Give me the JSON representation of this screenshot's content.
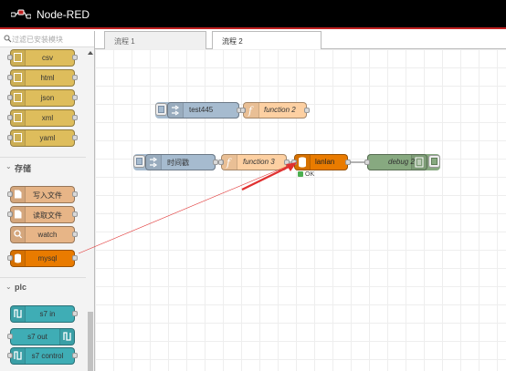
{
  "app": {
    "title": "Node-RED"
  },
  "palette": {
    "search_placeholder": "过滤已安装模块",
    "top_nodes": [
      {
        "label": "csv",
        "color": "#debd5c"
      },
      {
        "label": "html",
        "color": "#debd5c"
      },
      {
        "label": "json",
        "color": "#debd5c"
      },
      {
        "label": "xml",
        "color": "#debd5c"
      },
      {
        "label": "yaml",
        "color": "#debd5c"
      }
    ],
    "storage_category": "存储",
    "storage_nodes": [
      {
        "label": "写入文件",
        "color": "#e7b587"
      },
      {
        "label": "读取文件",
        "color": "#e7b587"
      },
      {
        "label": "watch",
        "color": "#e7b587"
      },
      {
        "label": "mysql",
        "color": "#e97b00"
      }
    ],
    "plc_category": "plc",
    "plc_nodes": [
      {
        "label": "s7 in",
        "color": "#3fadb5"
      },
      {
        "label": "s7 out",
        "color": "#3fadb5"
      },
      {
        "label": "s7 control",
        "color": "#3fadb5"
      }
    ]
  },
  "tabs": [
    {
      "label": "流程 1"
    },
    {
      "label": "流程 2"
    }
  ],
  "flow": {
    "inject1": {
      "label": "test445",
      "color": "#a6bbcf"
    },
    "function2": {
      "label": "function 2",
      "color": "#fdd0a2"
    },
    "inject2": {
      "label": "时间戳",
      "color": "#a6bbcf"
    },
    "function3": {
      "label": "function 3",
      "color": "#fdd0a2"
    },
    "mysql": {
      "label": "lanlan",
      "color": "#e97b00",
      "status": "OK"
    },
    "debug": {
      "label": "debug 2",
      "color": "#87a980"
    }
  },
  "colors": {
    "header_bg": "#000000",
    "accent": "#c02020",
    "drag_line": "#e03030"
  }
}
